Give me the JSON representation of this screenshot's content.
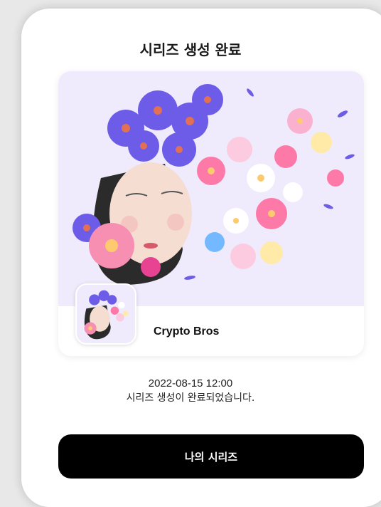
{
  "modal": {
    "title": "시리즈 생성 완료"
  },
  "series_card": {
    "artwork_icon": "flower-girl-artwork",
    "thumbnail_icon": "flower-girl-thumbnail",
    "name": "Crypto Bros"
  },
  "status": {
    "timestamp": "2022-08-15 12:00",
    "message": "시리즈 생성이 완료되었습니다."
  },
  "actions": {
    "primary_label": "나의 시리즈"
  },
  "colors": {
    "primary_button_bg": "#000000",
    "artwork_bg": "#efeafc"
  }
}
